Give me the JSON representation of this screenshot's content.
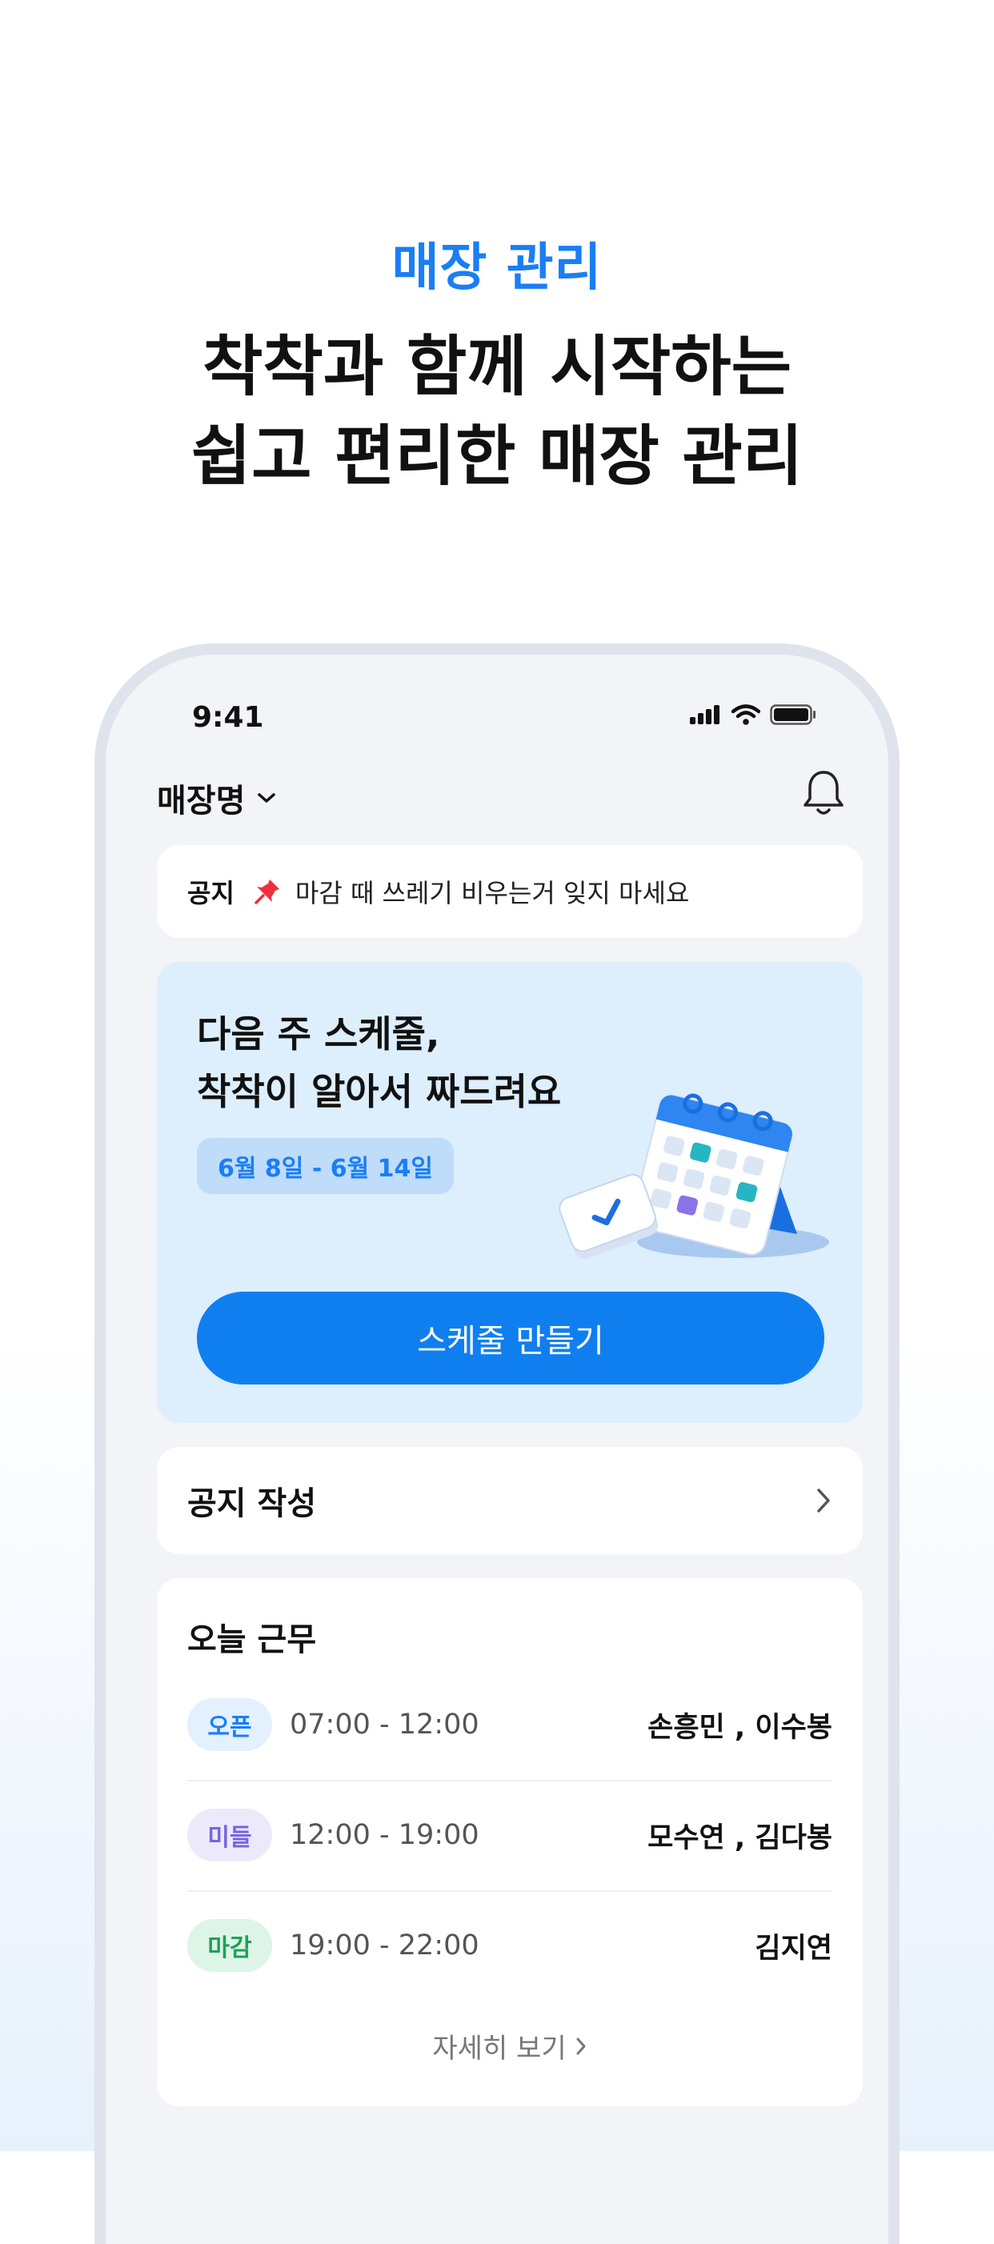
{
  "hero": {
    "subtitle": "매장 관리",
    "title_line1": "착착과 함께 시작하는",
    "title_line2": "쉽고 편리한 매장 관리"
  },
  "status_bar": {
    "time": "9:41"
  },
  "header": {
    "store_name": "매장명"
  },
  "notice": {
    "label": "공지",
    "text": "마감 때 쓰레기 비우는거 잊지 마세요"
  },
  "schedule_card": {
    "title_line1": "다음 주 스케줄,",
    "title_line2": "착착이 알아서 짜드려요",
    "date_range": "6월 8일 - 6월 14일",
    "button_label": "스케줄 만들기"
  },
  "write_notice": {
    "label": "공지 작성"
  },
  "today_work": {
    "title": "오늘 근무",
    "shifts": [
      {
        "badge": "오픈",
        "time": "07:00 - 12:00",
        "people": "손흥민 , 이수봉",
        "badge_bg": "#e3f0fd",
        "badge_color": "#1a7ef5"
      },
      {
        "badge": "미들",
        "time": "12:00 - 19:00",
        "people": "모수연 , 김다봉",
        "badge_bg": "#ece9fb",
        "badge_color": "#7a63e0"
      },
      {
        "badge": "마감",
        "time": "19:00 - 22:00",
        "people": "김지연",
        "badge_bg": "#dcf5e6",
        "badge_color": "#1f9f5c"
      }
    ],
    "more_label": "자세히 보기"
  },
  "colors": {
    "accent": "#1a7ef5",
    "button": "#0f7ff0",
    "schedule_bg": "#ddeefd"
  }
}
